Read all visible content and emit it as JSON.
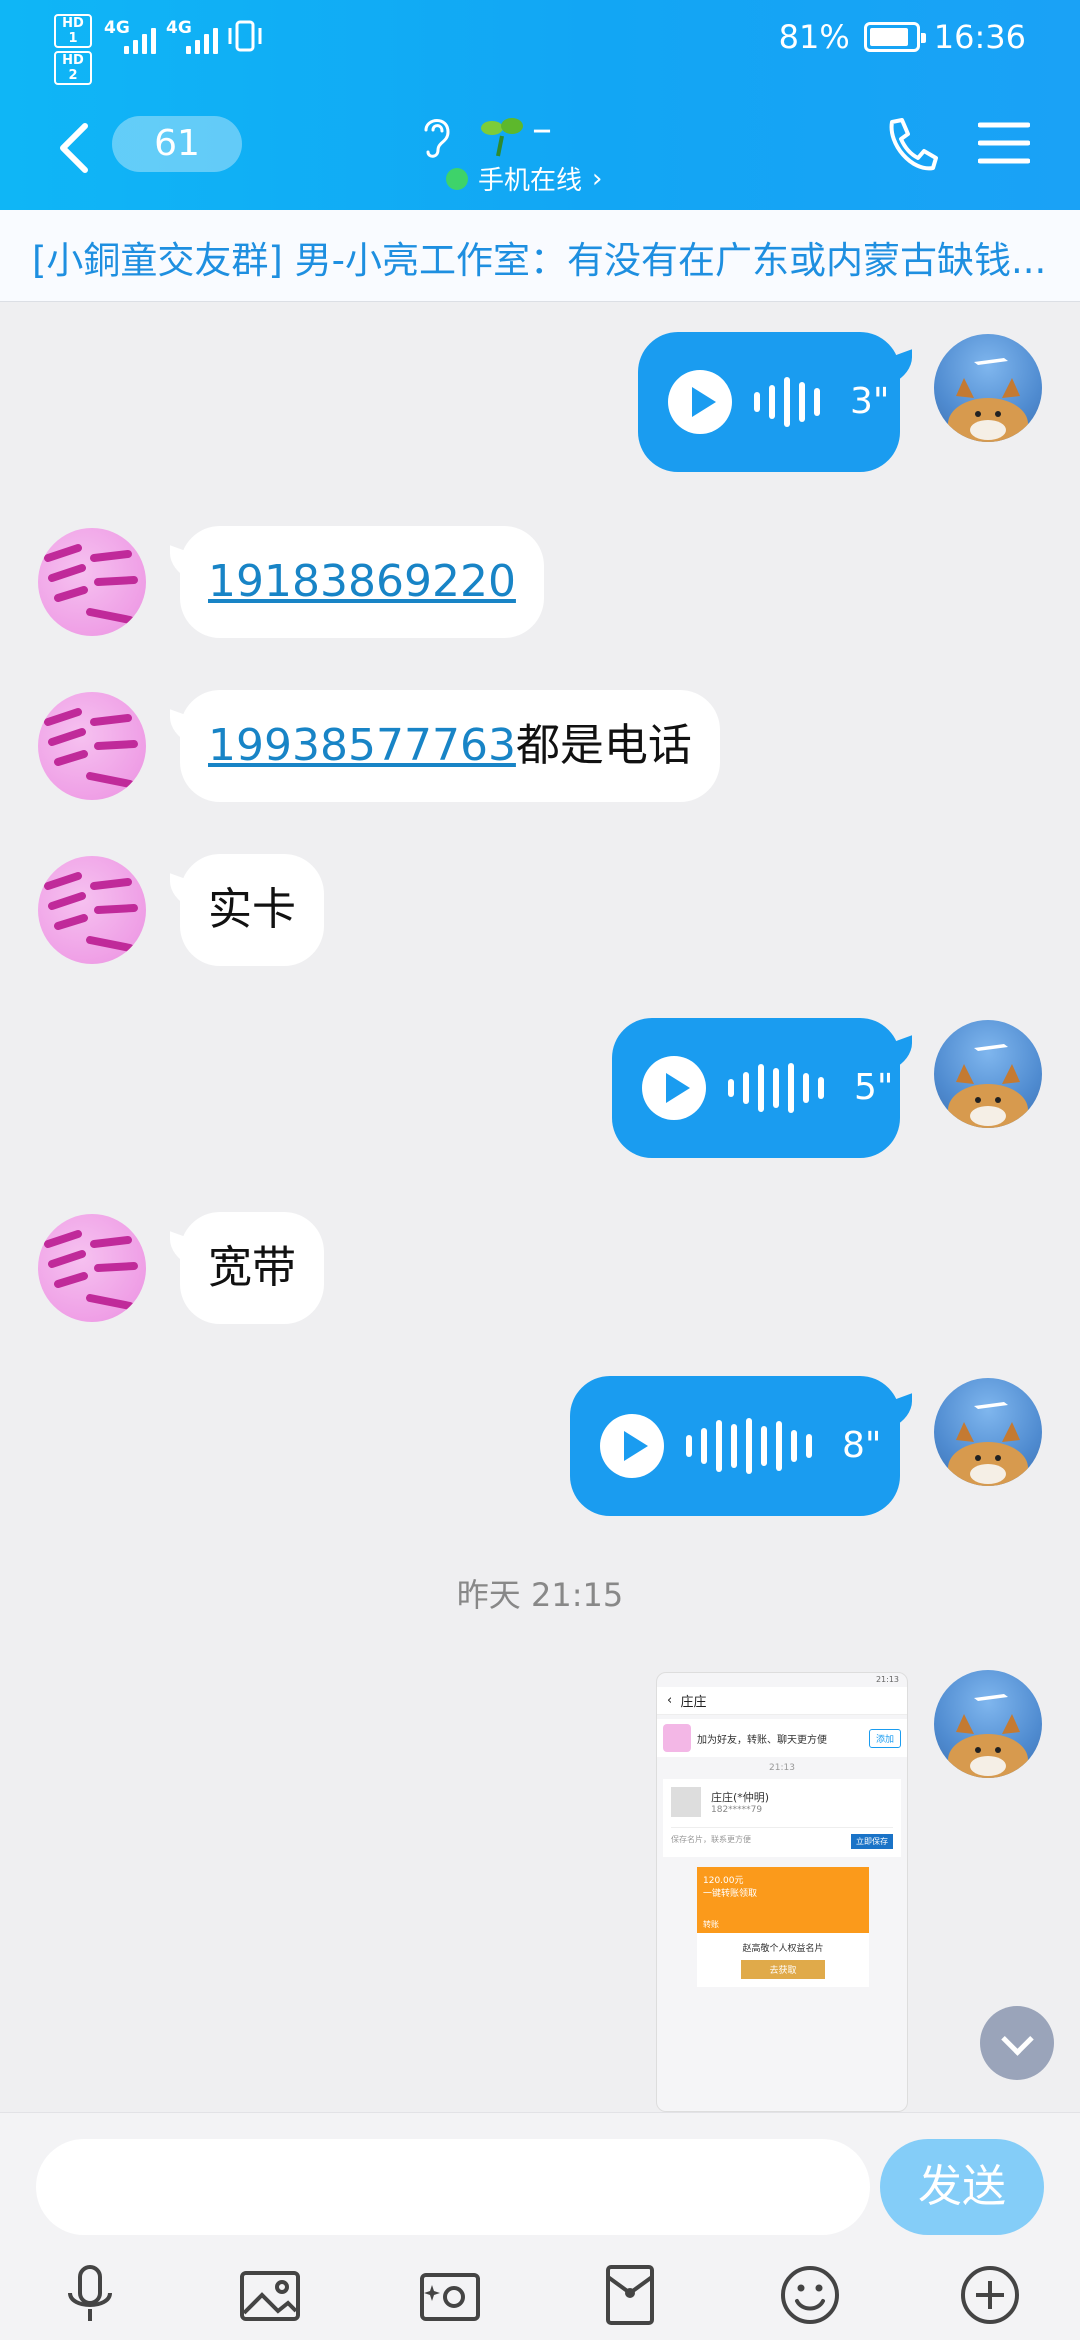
{
  "status_bar": {
    "hd1": "HD 1",
    "hd2": "HD 2",
    "net1": "4G",
    "net2": "4G",
    "battery": "81%",
    "time": "16:36"
  },
  "header": {
    "unread_count": "61",
    "contact_name": "–",
    "online_status": "手机在线",
    "online_chevron": "›"
  },
  "banner": {
    "text": "[小銅童交友群] 男-小亮工作室：有没有在广东或内蒙古缺钱..."
  },
  "messages": [
    {
      "type": "voice",
      "from": "me",
      "duration": "3\""
    },
    {
      "type": "text",
      "from": "other",
      "link": "19183869220",
      "text": ""
    },
    {
      "type": "text",
      "from": "other",
      "link": "19938577763",
      "text": "都是电话"
    },
    {
      "type": "text",
      "from": "other",
      "text": "实卡"
    },
    {
      "type": "voice",
      "from": "me",
      "duration": "5\""
    },
    {
      "type": "text",
      "from": "other",
      "text": "宽带"
    },
    {
      "type": "voice",
      "from": "me",
      "duration": "8\""
    }
  ],
  "time_divider": "昨天 21:15",
  "image_message": {
    "status_left": "",
    "status_right": "21:13",
    "title": "庄庄",
    "add_text": "加为好友，转账、聊天更方便",
    "add_button": "添加",
    "time": "21:13",
    "card_name": "庄庄(*仲明)",
    "card_phone": "182*****79",
    "card_hint": "保存名片，联系更方便",
    "card_save": "立即保存",
    "red_amount": "120.00元",
    "red_sub": "一键转账领取",
    "red_label": "转账",
    "red_foot": "赵高敬个人权益名片",
    "red_button": "去获取"
  },
  "input": {
    "placeholder": "",
    "send_label": "发送"
  },
  "colors": {
    "header": "#12a6f4",
    "bubble_out": "#1a9cf0",
    "link": "#1884c6",
    "banner_text": "#1e8fe0"
  }
}
